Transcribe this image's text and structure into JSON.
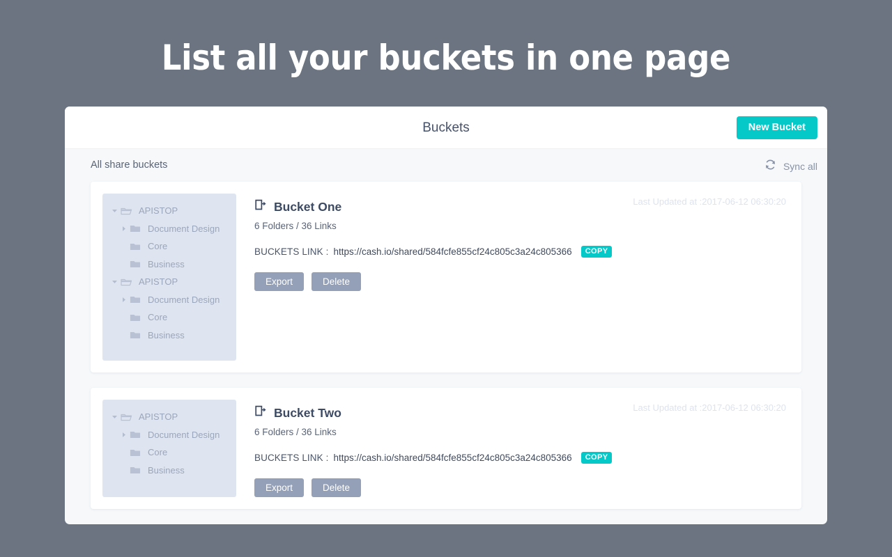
{
  "hero": {
    "title": "List all your buckets in one page"
  },
  "header": {
    "title": "Buckets",
    "new_bucket_label": "New Bucket"
  },
  "subheader": {
    "label": "All share buckets",
    "sync_label": "Sync all",
    "sync_icon": "refresh-icon"
  },
  "colors": {
    "page_background": "#6b7480",
    "accent_teal": "#04c9c8",
    "button_grey": "#93a0b8",
    "tree_panel": "#dfe5f0"
  },
  "labels": {
    "link_label": "BUCKETS LINK :",
    "copy_label": "COPY",
    "export_label": "Export",
    "delete_label": "Delete",
    "bucket_icon": "share-document-icon",
    "folder_open_icon": "folder-open-icon",
    "folder_icon": "folder-icon",
    "caret_down_icon": "caret-down-icon",
    "caret_right_icon": "caret-right-icon"
  },
  "buckets": [
    {
      "name": "Bucket One",
      "meta": "6 Folders / 36 Links",
      "timestamp": "Last Updated at :2017-06-12 06:30:20",
      "link": "https://cash.io/shared/584fcfe855cf24c805c3a24c805366",
      "tree": [
        {
          "label": "APISTOP",
          "level": 0,
          "caret": "down",
          "icon": "folder-open"
        },
        {
          "label": "Document Design",
          "level": 1,
          "caret": "right",
          "icon": "folder"
        },
        {
          "label": "Core",
          "level": 1,
          "caret": "none",
          "icon": "folder"
        },
        {
          "label": "Business",
          "level": 1,
          "caret": "none",
          "icon": "folder"
        },
        {
          "label": "APISTOP",
          "level": 0,
          "caret": "down",
          "icon": "folder-open"
        },
        {
          "label": "Document Design",
          "level": 1,
          "caret": "right",
          "icon": "folder"
        },
        {
          "label": "Core",
          "level": 1,
          "caret": "none",
          "icon": "folder"
        },
        {
          "label": "Business",
          "level": 1,
          "caret": "none",
          "icon": "folder"
        }
      ]
    },
    {
      "name": "Bucket Two",
      "meta": "6 Folders / 36 Links",
      "timestamp": "Last Updated at :2017-06-12 06:30:20",
      "link": "https://cash.io/shared/584fcfe855cf24c805c3a24c805366",
      "tree": [
        {
          "label": "APISTOP",
          "level": 0,
          "caret": "down",
          "icon": "folder-open"
        },
        {
          "label": "Document Design",
          "level": 1,
          "caret": "right",
          "icon": "folder"
        },
        {
          "label": "Core",
          "level": 1,
          "caret": "none",
          "icon": "folder"
        },
        {
          "label": "Business",
          "level": 1,
          "caret": "none",
          "icon": "folder"
        }
      ]
    }
  ]
}
